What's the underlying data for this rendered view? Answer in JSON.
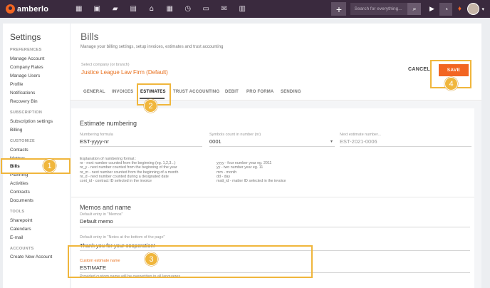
{
  "app": {
    "logo_text": "amberlo",
    "nav_icons": [
      "dashboard-icon",
      "contacts-icon",
      "matters-icon",
      "documents-icon",
      "billing-icon",
      "calendar-icon",
      "activity-icon",
      "folder-icon",
      "email-icon",
      "reports-icon"
    ],
    "search_placeholder": "Search for everything...",
    "plus_label": "+",
    "accent_color": "#f26522",
    "topbar_color": "#3a2a3e",
    "highlight_color": "#f0b63c"
  },
  "sidebar": {
    "title": "Settings",
    "sections": [
      {
        "label": "PREFERENCES",
        "items": [
          "Manage Account",
          "Company Rates",
          "Manage Users",
          "Profile",
          "Notifications",
          "Recovery Bin"
        ]
      },
      {
        "label": "SUBSCRIPTION",
        "items": [
          "Subscription settings",
          "Billing"
        ]
      },
      {
        "label": "CUSTOMIZE",
        "items": [
          "Contacts",
          "Matters",
          "Bills",
          "Planning",
          "Activities",
          "Contracts",
          "Documents"
        ]
      },
      {
        "label": "TOOLS",
        "items": [
          "Sharepoint",
          "Calendars",
          "E-mail"
        ]
      },
      {
        "label": "ACCOUNTS",
        "items": [
          "Create New Account"
        ]
      }
    ],
    "active_item": "Bills"
  },
  "main": {
    "title": "Bills",
    "subtitle": "Manage your billing settings, setup invoices, estimates and trust accounting",
    "company_label": "Select company (or branch)",
    "company_value": "Justice League Law Firm (Default)",
    "cancel_label": "CANCEL",
    "save_label": "SAVE",
    "tabs": [
      "GENERAL",
      "INVOICES",
      "ESTIMATES",
      "TRUST ACCOUNTING",
      "DEBIT",
      "PRO FORMA",
      "SENDING"
    ],
    "active_tab": "ESTIMATES"
  },
  "estimate_numbering": {
    "heading": "Estimate numbering",
    "formula_label": "Numbering formula",
    "formula_value": "EST-yyyy-nr",
    "symbols_label": "Symbols count in number (nr)",
    "symbols_value": "0001",
    "next_label": "Next estimate number...",
    "next_value": "EST-2021-0006",
    "explain_left": "Explanation of numbering format :\nnr - next number counted from the beginning (eg. 1,2,3...)\nnr_y - next number counted from the beginning of the year\nnr_m - next number counted from the beginning of a month\nnr_d - next number counted during a designated date\ncont_id - contract ID selected in the invoice",
    "explain_right": "\nyyyy - four number year eg. 2011\nyy - two number year eg. 11\nmm - month\ndd - day\nmatt_id - matter ID selected in the invoice"
  },
  "memos": {
    "heading": "Memos and name",
    "memo_label": "Default entry in \"Memos\"",
    "memo_value": "Default memo",
    "notes_label": "Default entry in \"Notes at the bottom of the page\"",
    "notes_value": "Thank you for your cooperation!",
    "custom_label": "Custom estimate name",
    "custom_value": "ESTIMATE",
    "custom_hint": "Provided custom name will be overwritten in all languages"
  },
  "annotations": [
    "1",
    "2",
    "3",
    "4"
  ]
}
